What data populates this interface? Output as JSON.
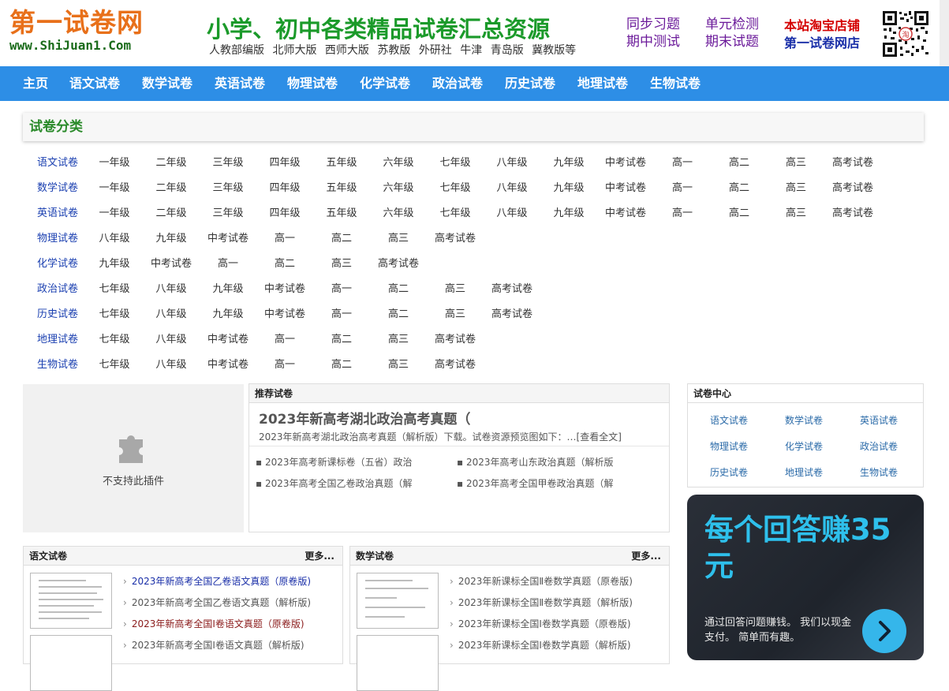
{
  "header": {
    "logo_cn": "第一试卷网",
    "logo_en": "www.ShiJuan1.Com",
    "slogan": "小学、初中各类精品试卷汇总资源",
    "editions": [
      "人教部编版",
      "北师大版",
      "西师大版",
      "苏教版",
      "外研社",
      "牛津",
      "青岛版",
      "冀教版等"
    ],
    "links_a": [
      "同步习题",
      "期中测试"
    ],
    "links_b": [
      "单元检测",
      "期末试题"
    ],
    "shop_line1": "本站淘宝店铺",
    "shop_line2": "第一试卷网店",
    "qr_icon": "qr-code-icon"
  },
  "nav": [
    "主页",
    "语文试卷",
    "数学试卷",
    "英语试卷",
    "物理试卷",
    "化学试卷",
    "政治试卷",
    "历史试卷",
    "地理试卷",
    "生物试卷"
  ],
  "category": {
    "title": "试卷分类",
    "rows": [
      [
        "语文试卷",
        "一年级",
        "二年级",
        "三年级",
        "四年级",
        "五年级",
        "六年级",
        "七年级",
        "八年级",
        "九年级",
        "中考试卷",
        "高一",
        "高二",
        "高三",
        "高考试卷"
      ],
      [
        "数学试卷",
        "一年级",
        "二年级",
        "三年级",
        "四年级",
        "五年级",
        "六年级",
        "七年级",
        "八年级",
        "九年级",
        "中考试卷",
        "高一",
        "高二",
        "高三",
        "高考试卷"
      ],
      [
        "英语试卷",
        "一年级",
        "二年级",
        "三年级",
        "四年级",
        "五年级",
        "六年级",
        "七年级",
        "八年级",
        "九年级",
        "中考试卷",
        "高一",
        "高二",
        "高三",
        "高考试卷"
      ],
      [
        "物理试卷",
        "八年级",
        "九年级",
        "中考试卷",
        "高一",
        "高二",
        "高三",
        "高考试卷"
      ],
      [
        "化学试卷",
        "九年级",
        "中考试卷",
        "高一",
        "高二",
        "高三",
        "高考试卷"
      ],
      [
        "政治试卷",
        "七年级",
        "八年级",
        "九年级",
        "中考试卷",
        "高一",
        "高二",
        "高三",
        "高考试卷"
      ],
      [
        "历史试卷",
        "七年级",
        "八年级",
        "九年级",
        "中考试卷",
        "高一",
        "高二",
        "高三",
        "高考试卷"
      ],
      [
        "地理试卷",
        "七年级",
        "八年级",
        "中考试卷",
        "高一",
        "高二",
        "高三",
        "高考试卷"
      ],
      [
        "生物试卷",
        "七年级",
        "八年级",
        "中考试卷",
        "高一",
        "高二",
        "高三",
        "高考试卷"
      ]
    ]
  },
  "plugin": {
    "text": "不支持此插件",
    "icon": "puzzle-piece-icon"
  },
  "recommend": {
    "title": "推荐试卷",
    "headline": "2023年新高考湖北政治高考真题（",
    "summary": "2023年新高考湖北政治高考真题（解析版）下载。试卷资源预览图如下：…[查看全文]",
    "items": [
      "2023年高考新课标卷（五省）政治",
      "2023年高考山东政治真题（解析版",
      "2023年高考全国乙卷政治真题（解",
      "2023年高考全国甲卷政治真题（解"
    ]
  },
  "center": {
    "title": "试卷中心",
    "items": [
      "语文试卷",
      "数学试卷",
      "英语试卷",
      "物理试卷",
      "化学试卷",
      "政治试卷",
      "历史试卷",
      "地理试卷",
      "生物试卷"
    ]
  },
  "promo": {
    "headline": "每个回答赚35元",
    "text": "通过回答问题赚钱。 我们以现金支付。 简单而有趣。",
    "button_icon": "chevron-right-icon",
    "accent": "#2ec0ec"
  },
  "chinese_list": {
    "title": "语文试卷",
    "more": "更多...",
    "items": [
      "2023年新高考全国乙卷语文真题（原卷版)",
      "2023年新高考全国乙卷语文真题（解析版)",
      "2023年新高考全国Ⅰ卷语文真题（原卷版)",
      "2023年新高考全国Ⅰ卷语文真题（解析版)"
    ]
  },
  "math_list": {
    "title": "数学试卷",
    "more": "更多...",
    "items": [
      "2023年新课标全国Ⅱ卷数学真题（原卷版)",
      "2023年新课标全国Ⅱ卷数学真题（解析版)",
      "2023年新课标全国Ⅰ卷数学真题（原卷版)",
      "2023年新课标全国Ⅰ卷数学真题（解析版)"
    ]
  }
}
